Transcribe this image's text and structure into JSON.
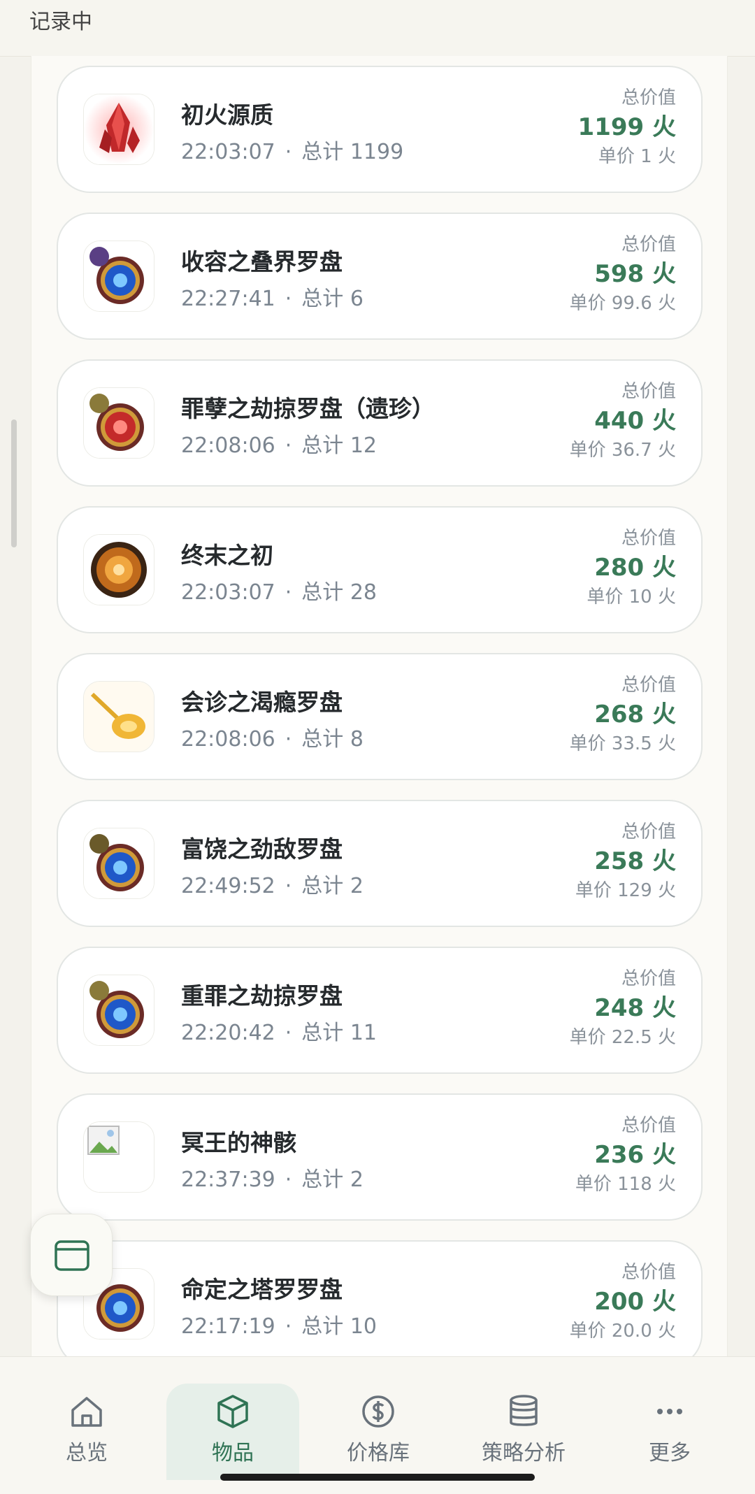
{
  "status": {
    "text": "记录中"
  },
  "list": {
    "total_label": "总价值",
    "items": [
      {
        "name": "初火源质",
        "time": "22:03:07",
        "count": "总计 1199",
        "total": "1199 火",
        "unit": "单价 1 火",
        "icon": "red-crystal-icon"
      },
      {
        "name": "收容之叠界罗盘",
        "time": "22:27:41",
        "count": "总计 6",
        "total": "598 火",
        "unit": "单价 99.6 火",
        "icon": "blue-compass-icon"
      },
      {
        "name": "罪孽之劫掠罗盘（遗珍）",
        "time": "22:08:06",
        "count": "总计 12",
        "total": "440 火",
        "unit": "单价 36.7 火",
        "icon": "red-compass-icon"
      },
      {
        "name": "终末之初",
        "time": "22:03:07",
        "count": "总计 28",
        "total": "280 火",
        "unit": "单价 10 火",
        "icon": "orange-orb-icon"
      },
      {
        "name": "会诊之渴瘾罗盘",
        "time": "22:08:06",
        "count": "总计 8",
        "total": "268 火",
        "unit": "单价 33.5 火",
        "icon": "golden-key-icon"
      },
      {
        "name": "富饶之劲敌罗盘",
        "time": "22:49:52",
        "count": "总计 2",
        "total": "258 火",
        "unit": "单价 129 火",
        "icon": "blue-compass-icon"
      },
      {
        "name": "重罪之劫掠罗盘",
        "time": "22:20:42",
        "count": "总计 11",
        "total": "248 火",
        "unit": "单价 22.5 火",
        "icon": "blue-compass-icon"
      },
      {
        "name": "冥王的神骸",
        "time": "22:37:39",
        "count": "总计 2",
        "total": "236 火",
        "unit": "单价 118 火",
        "icon": "broken-image-icon"
      },
      {
        "name": "命定之塔罗罗盘",
        "time": "22:17:19",
        "count": "总计 10",
        "total": "200 火",
        "unit": "单价 20.0 火",
        "icon": "blue-compass-icon"
      }
    ]
  },
  "nav": {
    "items": [
      {
        "label": "总览",
        "icon": "home-icon"
      },
      {
        "label": "物品",
        "icon": "box-icon"
      },
      {
        "label": "价格库",
        "icon": "dollar-icon"
      },
      {
        "label": "策略分析",
        "icon": "database-icon"
      },
      {
        "label": "更多",
        "icon": "more-icon"
      }
    ]
  },
  "colors": {
    "accent": "#3a7a58",
    "active_tab_bg": "#e6efe9"
  }
}
